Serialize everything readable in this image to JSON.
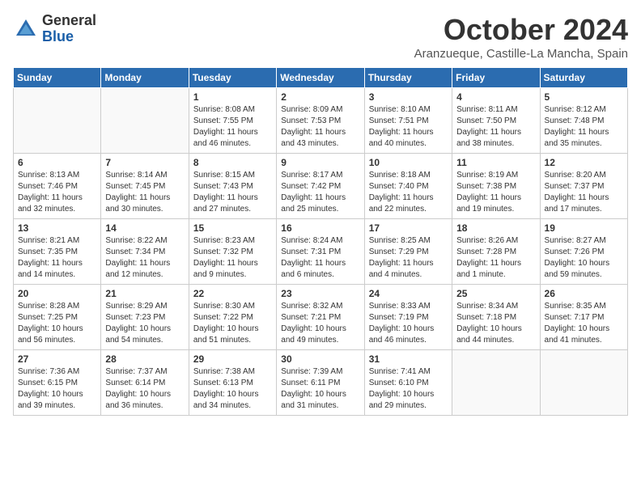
{
  "header": {
    "logo_general": "General",
    "logo_blue": "Blue",
    "title": "October 2024",
    "location": "Aranzueque, Castille-La Mancha, Spain"
  },
  "days_of_week": [
    "Sunday",
    "Monday",
    "Tuesday",
    "Wednesday",
    "Thursday",
    "Friday",
    "Saturday"
  ],
  "weeks": [
    [
      {
        "day": "",
        "empty": true
      },
      {
        "day": "",
        "empty": true
      },
      {
        "day": "1",
        "sunrise": "Sunrise: 8:08 AM",
        "sunset": "Sunset: 7:55 PM",
        "daylight": "Daylight: 11 hours and 46 minutes."
      },
      {
        "day": "2",
        "sunrise": "Sunrise: 8:09 AM",
        "sunset": "Sunset: 7:53 PM",
        "daylight": "Daylight: 11 hours and 43 minutes."
      },
      {
        "day": "3",
        "sunrise": "Sunrise: 8:10 AM",
        "sunset": "Sunset: 7:51 PM",
        "daylight": "Daylight: 11 hours and 40 minutes."
      },
      {
        "day": "4",
        "sunrise": "Sunrise: 8:11 AM",
        "sunset": "Sunset: 7:50 PM",
        "daylight": "Daylight: 11 hours and 38 minutes."
      },
      {
        "day": "5",
        "sunrise": "Sunrise: 8:12 AM",
        "sunset": "Sunset: 7:48 PM",
        "daylight": "Daylight: 11 hours and 35 minutes."
      }
    ],
    [
      {
        "day": "6",
        "sunrise": "Sunrise: 8:13 AM",
        "sunset": "Sunset: 7:46 PM",
        "daylight": "Daylight: 11 hours and 32 minutes."
      },
      {
        "day": "7",
        "sunrise": "Sunrise: 8:14 AM",
        "sunset": "Sunset: 7:45 PM",
        "daylight": "Daylight: 11 hours and 30 minutes."
      },
      {
        "day": "8",
        "sunrise": "Sunrise: 8:15 AM",
        "sunset": "Sunset: 7:43 PM",
        "daylight": "Daylight: 11 hours and 27 minutes."
      },
      {
        "day": "9",
        "sunrise": "Sunrise: 8:17 AM",
        "sunset": "Sunset: 7:42 PM",
        "daylight": "Daylight: 11 hours and 25 minutes."
      },
      {
        "day": "10",
        "sunrise": "Sunrise: 8:18 AM",
        "sunset": "Sunset: 7:40 PM",
        "daylight": "Daylight: 11 hours and 22 minutes."
      },
      {
        "day": "11",
        "sunrise": "Sunrise: 8:19 AM",
        "sunset": "Sunset: 7:38 PM",
        "daylight": "Daylight: 11 hours and 19 minutes."
      },
      {
        "day": "12",
        "sunrise": "Sunrise: 8:20 AM",
        "sunset": "Sunset: 7:37 PM",
        "daylight": "Daylight: 11 hours and 17 minutes."
      }
    ],
    [
      {
        "day": "13",
        "sunrise": "Sunrise: 8:21 AM",
        "sunset": "Sunset: 7:35 PM",
        "daylight": "Daylight: 11 hours and 14 minutes."
      },
      {
        "day": "14",
        "sunrise": "Sunrise: 8:22 AM",
        "sunset": "Sunset: 7:34 PM",
        "daylight": "Daylight: 11 hours and 12 minutes."
      },
      {
        "day": "15",
        "sunrise": "Sunrise: 8:23 AM",
        "sunset": "Sunset: 7:32 PM",
        "daylight": "Daylight: 11 hours and 9 minutes."
      },
      {
        "day": "16",
        "sunrise": "Sunrise: 8:24 AM",
        "sunset": "Sunset: 7:31 PM",
        "daylight": "Daylight: 11 hours and 6 minutes."
      },
      {
        "day": "17",
        "sunrise": "Sunrise: 8:25 AM",
        "sunset": "Sunset: 7:29 PM",
        "daylight": "Daylight: 11 hours and 4 minutes."
      },
      {
        "day": "18",
        "sunrise": "Sunrise: 8:26 AM",
        "sunset": "Sunset: 7:28 PM",
        "daylight": "Daylight: 11 hours and 1 minute."
      },
      {
        "day": "19",
        "sunrise": "Sunrise: 8:27 AM",
        "sunset": "Sunset: 7:26 PM",
        "daylight": "Daylight: 10 hours and 59 minutes."
      }
    ],
    [
      {
        "day": "20",
        "sunrise": "Sunrise: 8:28 AM",
        "sunset": "Sunset: 7:25 PM",
        "daylight": "Daylight: 10 hours and 56 minutes."
      },
      {
        "day": "21",
        "sunrise": "Sunrise: 8:29 AM",
        "sunset": "Sunset: 7:23 PM",
        "daylight": "Daylight: 10 hours and 54 minutes."
      },
      {
        "day": "22",
        "sunrise": "Sunrise: 8:30 AM",
        "sunset": "Sunset: 7:22 PM",
        "daylight": "Daylight: 10 hours and 51 minutes."
      },
      {
        "day": "23",
        "sunrise": "Sunrise: 8:32 AM",
        "sunset": "Sunset: 7:21 PM",
        "daylight": "Daylight: 10 hours and 49 minutes."
      },
      {
        "day": "24",
        "sunrise": "Sunrise: 8:33 AM",
        "sunset": "Sunset: 7:19 PM",
        "daylight": "Daylight: 10 hours and 46 minutes."
      },
      {
        "day": "25",
        "sunrise": "Sunrise: 8:34 AM",
        "sunset": "Sunset: 7:18 PM",
        "daylight": "Daylight: 10 hours and 44 minutes."
      },
      {
        "day": "26",
        "sunrise": "Sunrise: 8:35 AM",
        "sunset": "Sunset: 7:17 PM",
        "daylight": "Daylight: 10 hours and 41 minutes."
      }
    ],
    [
      {
        "day": "27",
        "sunrise": "Sunrise: 7:36 AM",
        "sunset": "Sunset: 6:15 PM",
        "daylight": "Daylight: 10 hours and 39 minutes."
      },
      {
        "day": "28",
        "sunrise": "Sunrise: 7:37 AM",
        "sunset": "Sunset: 6:14 PM",
        "daylight": "Daylight: 10 hours and 36 minutes."
      },
      {
        "day": "29",
        "sunrise": "Sunrise: 7:38 AM",
        "sunset": "Sunset: 6:13 PM",
        "daylight": "Daylight: 10 hours and 34 minutes."
      },
      {
        "day": "30",
        "sunrise": "Sunrise: 7:39 AM",
        "sunset": "Sunset: 6:11 PM",
        "daylight": "Daylight: 10 hours and 31 minutes."
      },
      {
        "day": "31",
        "sunrise": "Sunrise: 7:41 AM",
        "sunset": "Sunset: 6:10 PM",
        "daylight": "Daylight: 10 hours and 29 minutes."
      },
      {
        "day": "",
        "empty": true
      },
      {
        "day": "",
        "empty": true
      }
    ]
  ]
}
